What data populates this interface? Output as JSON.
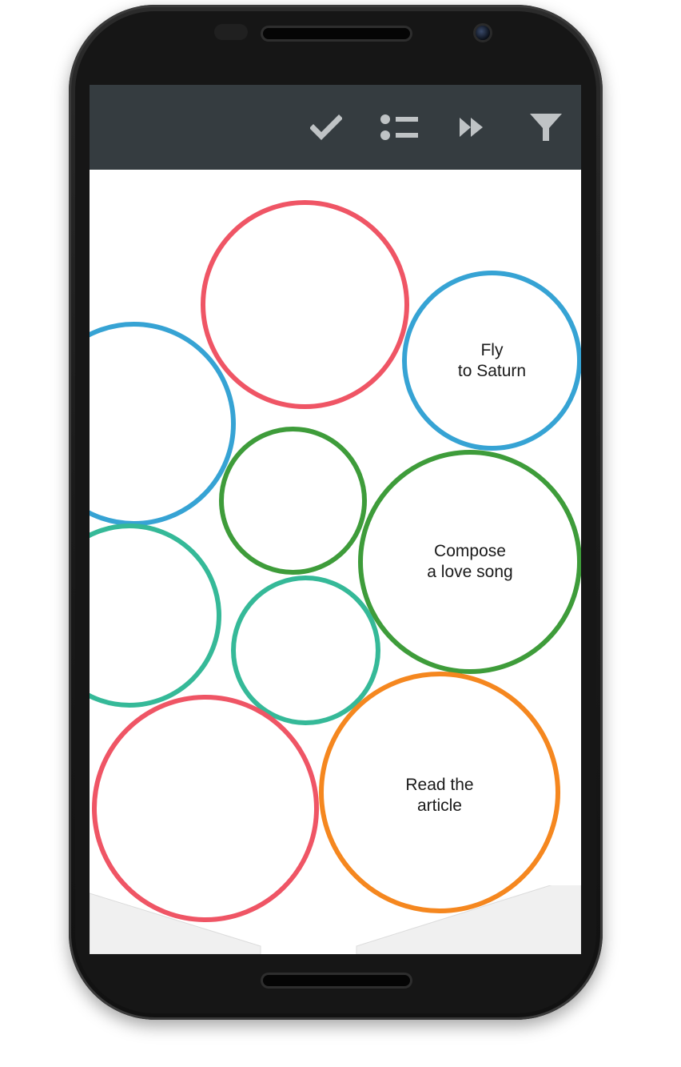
{
  "toolbar": {
    "background": "#353c40",
    "icon_color": "#bfc3c5",
    "actions": [
      {
        "name": "complete",
        "icon": "check-icon"
      },
      {
        "name": "list",
        "icon": "list-icon"
      },
      {
        "name": "skip",
        "icon": "fast-forward-icon"
      },
      {
        "name": "filter",
        "icon": "filter-icon"
      }
    ]
  },
  "bubbles": [
    {
      "label": "",
      "color": "#ef5565"
    },
    {
      "label": "Fly\nto Saturn",
      "color": "#36a3d4"
    },
    {
      "label": "",
      "color": "#36a3d4"
    },
    {
      "label": "",
      "color": "#3e9c3a"
    },
    {
      "label": "Compose\na love song",
      "color": "#3e9c3a"
    },
    {
      "label": "",
      "color": "#35b998"
    },
    {
      "label": "",
      "color": "#35b998"
    },
    {
      "label": "",
      "color": "#ef5565"
    },
    {
      "label": "Read the\narticle",
      "color": "#f5871f"
    }
  ],
  "fab": {
    "label": "+",
    "color": "#3dba63"
  }
}
